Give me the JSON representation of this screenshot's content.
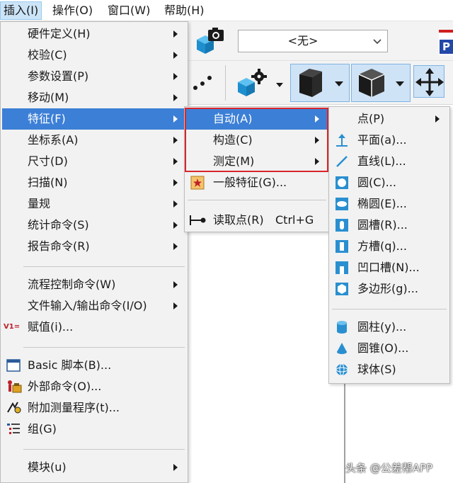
{
  "menubar": {
    "items": [
      {
        "label": "插入(I)"
      },
      {
        "label": "操作(O)"
      },
      {
        "label": "窗口(W)"
      },
      {
        "label": "帮助(H)"
      }
    ]
  },
  "toolbar": {
    "combo_value": "<无>",
    "partial_label": "P"
  },
  "main_menu": {
    "items": [
      {
        "label": "硬件定义(H)"
      },
      {
        "label": "校验(C)"
      },
      {
        "label": "参数设置(P)"
      },
      {
        "label": "移动(M)"
      },
      {
        "label": "特征(F)"
      },
      {
        "label": "坐标系(A)"
      },
      {
        "label": "尺寸(D)"
      },
      {
        "label": "扫描(N)"
      },
      {
        "label": "量规"
      },
      {
        "label": "统计命令(S)"
      },
      {
        "label": "报告命令(R)"
      },
      {
        "label": "流程控制命令(W)"
      },
      {
        "label": "文件输入/输出命令(I/O)"
      },
      {
        "label": "赋值(i)..."
      },
      {
        "label": "Basic 脚本(B)..."
      },
      {
        "label": "外部命令(O)..."
      },
      {
        "label": "附加测量程序(t)..."
      },
      {
        "label": "组(G)"
      },
      {
        "label": "模块(u)"
      }
    ],
    "assign_icon_text": "V1="
  },
  "feature_menu": {
    "items": [
      {
        "label": "自动(A)"
      },
      {
        "label": "构造(C)"
      },
      {
        "label": "测定(M)"
      },
      {
        "label": "一般特征(G)..."
      },
      {
        "label": "读取点(R)",
        "shortcut": "Ctrl+G"
      }
    ]
  },
  "auto_menu": {
    "items": [
      {
        "label": "点(P)"
      },
      {
        "label": "平面(a)..."
      },
      {
        "label": "直线(L)..."
      },
      {
        "label": "圆(C)..."
      },
      {
        "label": "椭圆(E)..."
      },
      {
        "label": "圆槽(R)..."
      },
      {
        "label": "方槽(q)..."
      },
      {
        "label": "凹口槽(N)..."
      },
      {
        "label": "多边形(g)..."
      },
      {
        "label": "圆柱(y)..."
      },
      {
        "label": "圆锥(O)..."
      },
      {
        "label": "球体(S)"
      }
    ]
  },
  "watermark": "头条 @公差帮APP",
  "colors": {
    "selection": "#3c7fd6",
    "highlight_box": "#d9262c",
    "icon_blue": "#2a8fd0"
  }
}
